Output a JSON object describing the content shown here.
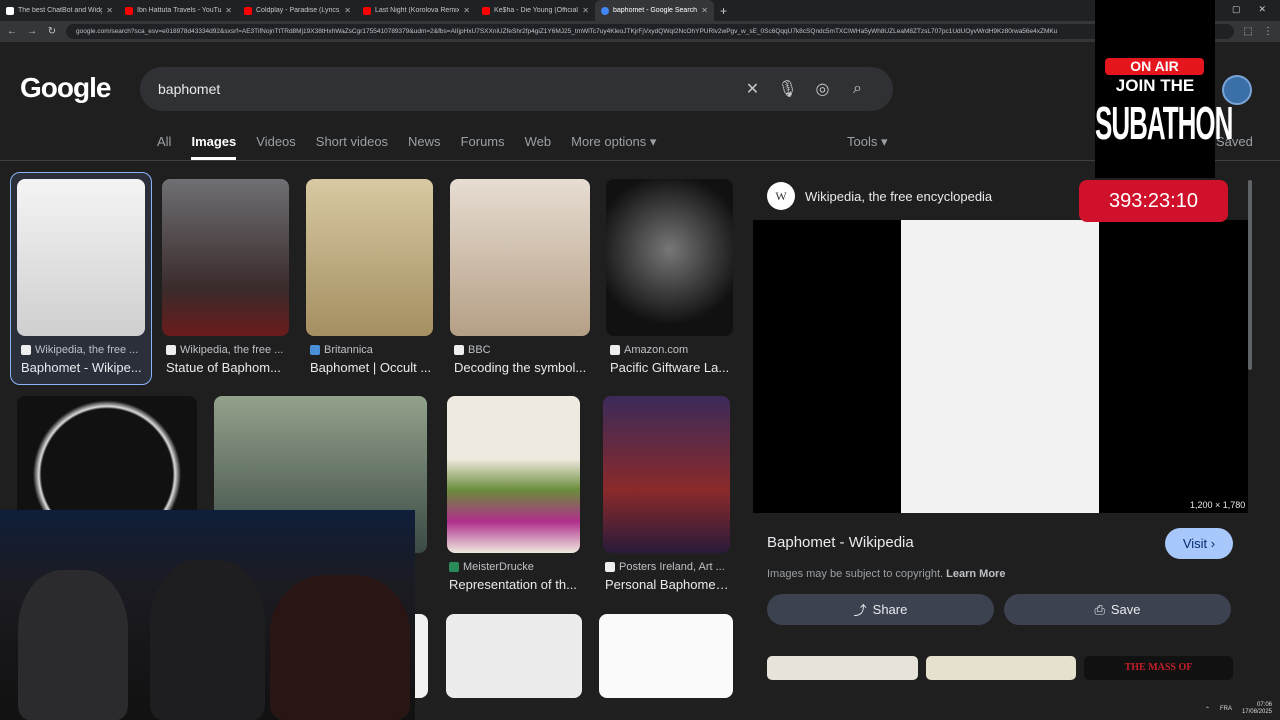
{
  "tabs": [
    {
      "title": "The best ChatBot and Widgets",
      "color": "#ffffff"
    },
    {
      "title": "Ibn Hattuta Travels - YouTube",
      "color": "#ff0000"
    },
    {
      "title": "Coldplay - Paradise (Lyrics) - Yo",
      "color": "#ff0000"
    },
    {
      "title": "Last Night (Korolova Remix) - Y",
      "color": "#ff0000"
    },
    {
      "title": "Ke$ha - Die Young (Official Vide",
      "color": "#ff0000"
    },
    {
      "title": "baphomet - Google Search",
      "color": "#4285f4"
    }
  ],
  "address": {
    "url": "google.com/search?sca_esv=e018978d43334d92&sxsrf=AE3TifNojnTtTRd8Mj19X38tHxhWaZsCgr1755410789379&udm=2&fbs=AIIjpHxU7SXXniUZfeShr2fp4giZ1Y6MJ25_tmWlTc7uy4KleoJTKjrFjVxydQWqI2NcOhYPURlv2wPgv_w_sE_0Sc6QqqU7k8cSQndc5mTXCIWHa5yWh8UZLeaM8ZTzsL707pc1UdUOyvWrdH9Kz80rwa56e4xZMKu"
  },
  "search": {
    "logo": "Google",
    "query": "baphomet"
  },
  "nav": {
    "tabs": [
      "All",
      "Images",
      "Videos",
      "Short videos",
      "News",
      "Forums",
      "Web",
      "More options"
    ],
    "active": "Images",
    "tools": "Tools",
    "saved": "Saved"
  },
  "results_row1": [
    {
      "source": "Wikipedia, the free ...",
      "title": "Baphomet - Wikipe..."
    },
    {
      "source": "Wikipedia, the free ...",
      "title": "Statue of Baphom..."
    },
    {
      "source": "Britannica",
      "title": "Baphomet | Occult ..."
    },
    {
      "source": "BBC",
      "title": "Decoding the symbol..."
    },
    {
      "source": "Amazon.com",
      "title": "Pacific Giftware La..."
    }
  ],
  "results_row2": [
    {
      "source": "MeisterDrucke",
      "title": "Representation of th..."
    },
    {
      "source": "Posters Ireland, Art ...",
      "title": "Personal Baphomet..."
    }
  ],
  "panel": {
    "source": "Wikipedia, the free encyclopedia",
    "dimensions": "1,200 × 1,780",
    "title": "Baphomet - Wikipedia",
    "visit": "Visit",
    "copyright": "Images may be subject to copyright.",
    "learn_more": "Learn More",
    "share": "Share",
    "save": "Save",
    "thumb_text": "THE MASS OF"
  },
  "overlay": {
    "on_air": "ON AIR",
    "join": "JOIN THE",
    "subathon": "SUBATHON",
    "timer": "393:23:10"
  },
  "taskbar": {
    "lang": "FRA",
    "time": "07:06",
    "date": "17/08/2025"
  }
}
